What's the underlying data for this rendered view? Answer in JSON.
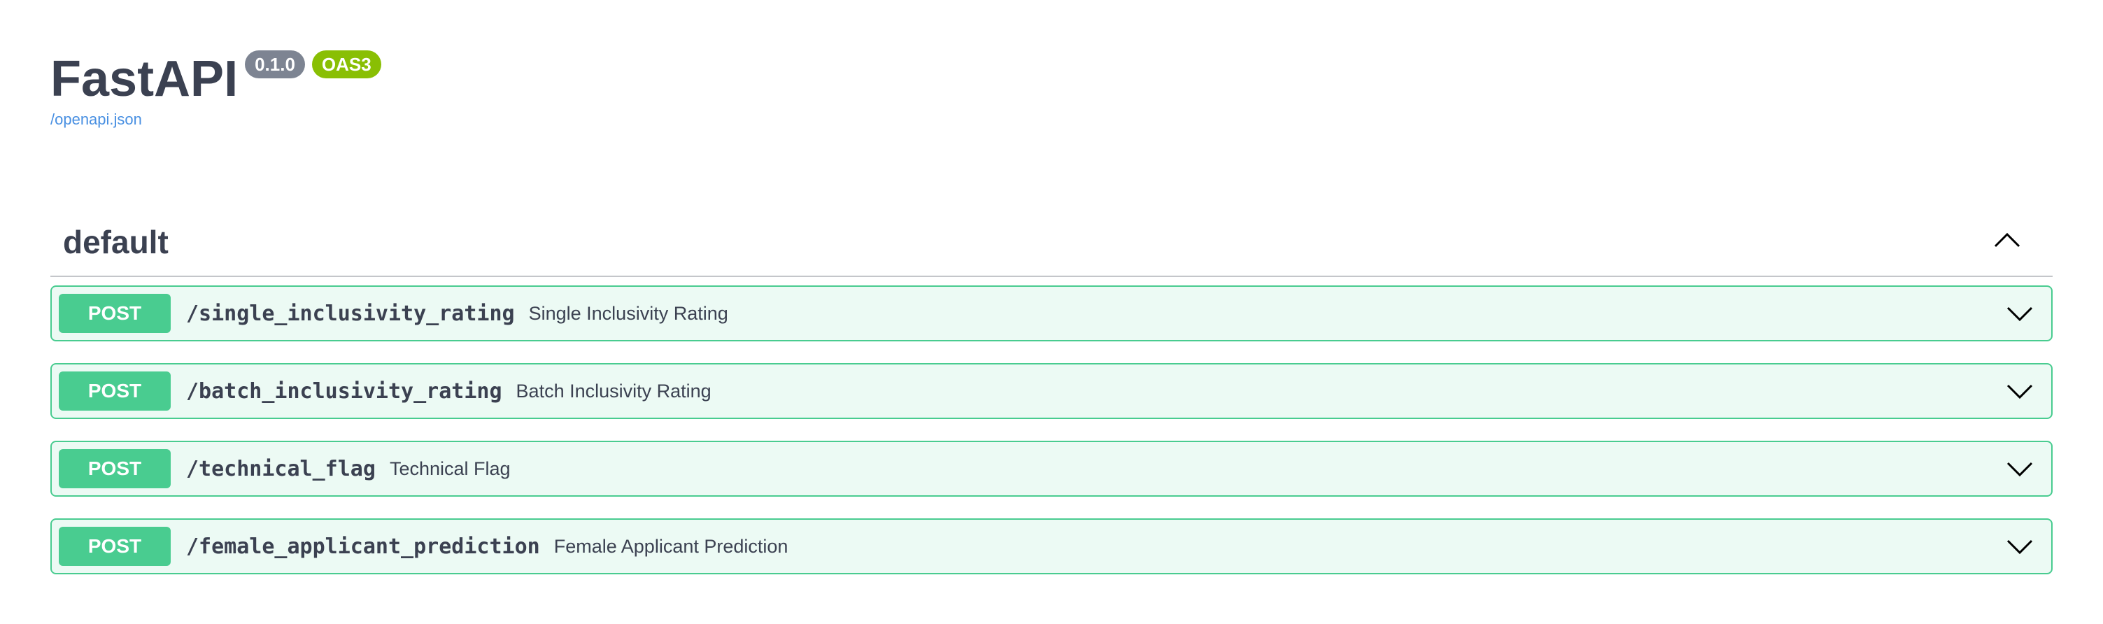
{
  "info": {
    "title": "FastAPI",
    "version": "0.1.0",
    "oas_badge": "OAS3",
    "spec_link": "/openapi.json"
  },
  "section": {
    "title": "default",
    "collapse_icon": "chevron-up-icon"
  },
  "operations": [
    {
      "method": "POST",
      "path": "/single_inclusivity_rating",
      "summary": "Single Inclusivity Rating",
      "expand_icon": "chevron-down-icon"
    },
    {
      "method": "POST",
      "path": "/batch_inclusivity_rating",
      "summary": "Batch Inclusivity Rating",
      "expand_icon": "chevron-down-icon"
    },
    {
      "method": "POST",
      "path": "/technical_flag",
      "summary": "Technical Flag",
      "expand_icon": "chevron-down-icon"
    },
    {
      "method": "POST",
      "path": "/female_applicant_prediction",
      "summary": "Female Applicant Prediction",
      "expand_icon": "chevron-down-icon"
    }
  ],
  "colors": {
    "text": "#3b4151",
    "post_green": "#49cc90",
    "version_badge": "#7d8492",
    "oas_badge": "#89bf04",
    "link": "#4990e2"
  }
}
